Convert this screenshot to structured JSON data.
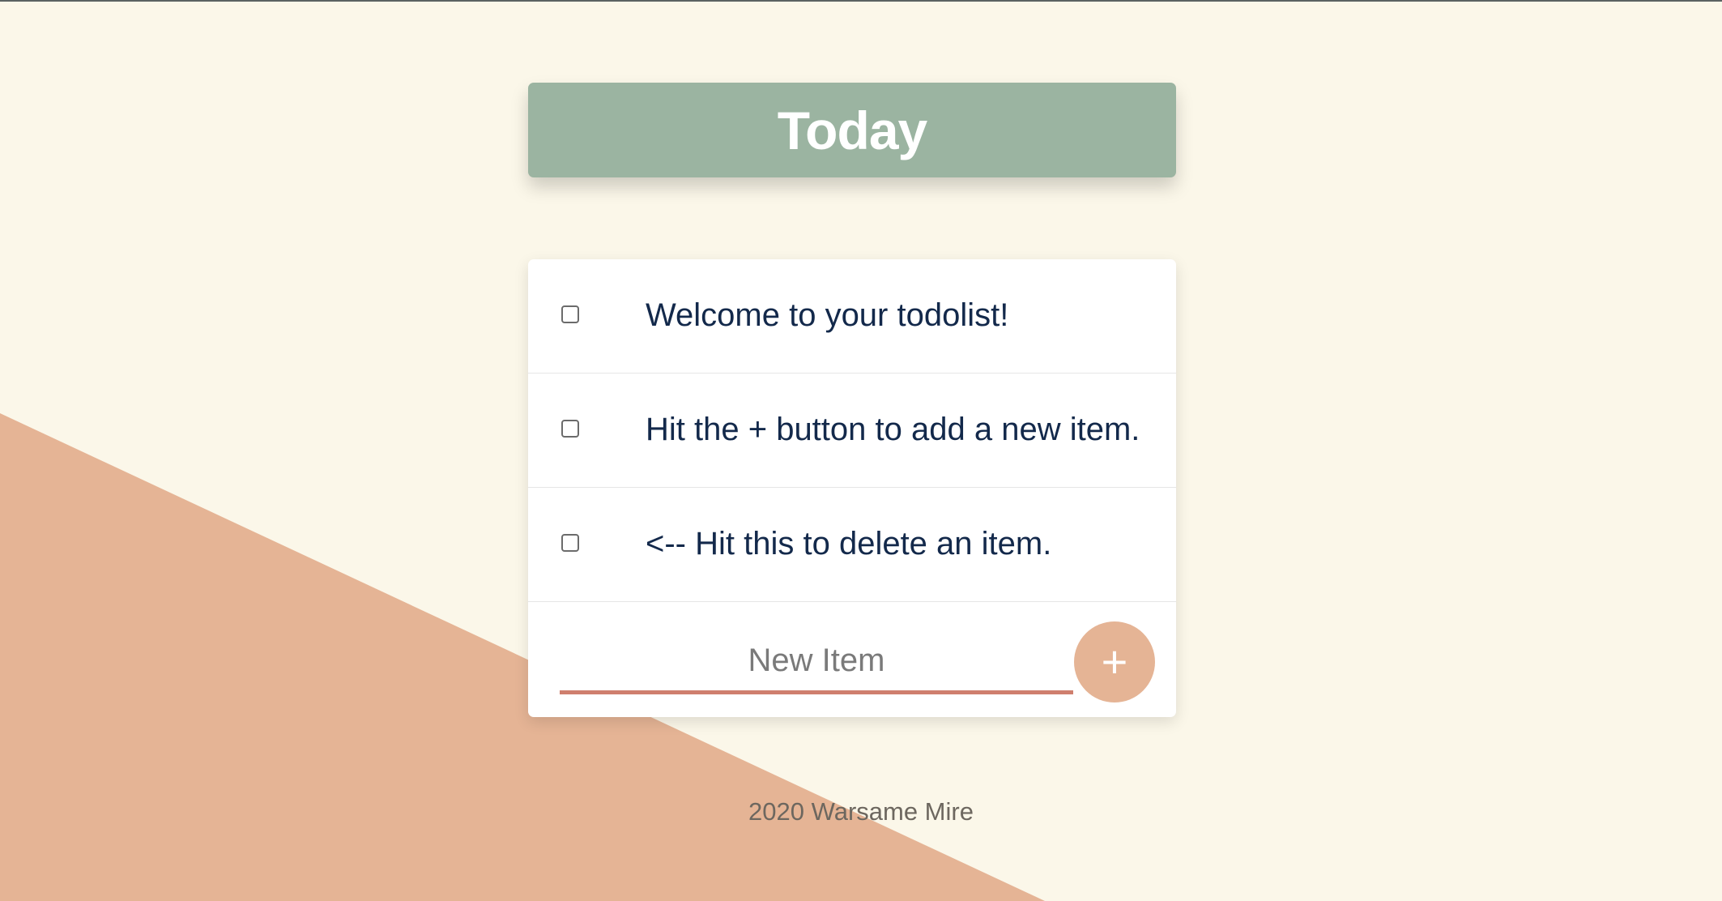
{
  "colors": {
    "background": "#fbf7e9",
    "accent_shape": "#e5b495",
    "heading_bg": "#9bb4a1",
    "item_text": "#13294b",
    "input_underline": "#cf7f6e"
  },
  "header": {
    "title": "Today"
  },
  "todo": {
    "items": [
      {
        "text": "Welcome to your todolist!",
        "checked": false
      },
      {
        "text": "Hit the + button to add a new item.",
        "checked": false
      },
      {
        "text": "<-- Hit this to delete an item.",
        "checked": false
      }
    ],
    "new_item": {
      "placeholder": "New Item",
      "value": "",
      "add_label": "+"
    }
  },
  "footer": {
    "text": "2020 Warsame Mire"
  }
}
